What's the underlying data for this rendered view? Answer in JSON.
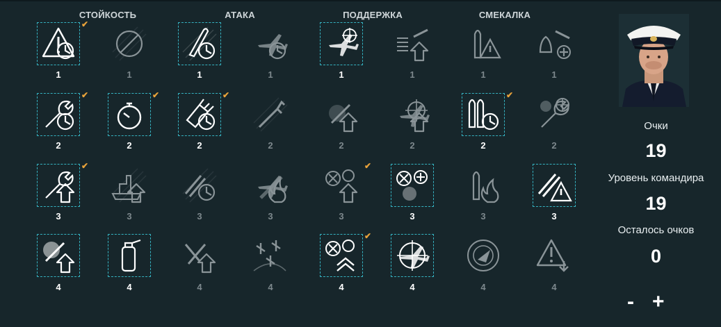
{
  "categories": [
    "СТОЙКОСТЬ",
    "АТАКА",
    "ПОДДЕРЖКА",
    "СМЕКАЛКА"
  ],
  "skills": [
    [
      {
        "icon": "warning-timer-icon",
        "level": "1",
        "selected": true,
        "checked": true
      },
      {
        "icon": "no-aa-icon",
        "level": "1",
        "selected": false,
        "checked": false
      },
      {
        "icon": "torpedo-timer-icon",
        "level": "1",
        "selected": true,
        "checked": false
      },
      {
        "icon": "plane-timer-icon",
        "level": "1",
        "selected": false,
        "checked": false
      },
      {
        "icon": "plane-target-icon",
        "level": "1",
        "selected": true,
        "checked": false
      },
      {
        "icon": "plane-upgrade-icon",
        "level": "1",
        "selected": false,
        "checked": false
      },
      {
        "icon": "torpedo-warning-icon",
        "level": "1",
        "selected": false,
        "checked": false
      },
      {
        "icon": "bomb-plane-heal-icon",
        "level": "1",
        "selected": false,
        "checked": false
      }
    ],
    [
      {
        "icon": "wrench-timer-icon",
        "level": "2",
        "selected": true,
        "checked": true
      },
      {
        "icon": "stopwatch-icon",
        "level": "2",
        "selected": true,
        "checked": true
      },
      {
        "icon": "gun-timer-icon",
        "level": "2",
        "selected": true,
        "checked": true
      },
      {
        "icon": "shell-upgrade-icon",
        "level": "2",
        "selected": false,
        "checked": false
      },
      {
        "icon": "explosion-upgrade-icon",
        "level": "2",
        "selected": false,
        "checked": false
      },
      {
        "icon": "plane-crosshair-upgrade-icon",
        "level": "2",
        "selected": false,
        "checked": false
      },
      {
        "icon": "torpedo-pair-timer-icon",
        "level": "2",
        "selected": true,
        "checked": true
      },
      {
        "icon": "fire-wrench-wheel-icon",
        "level": "2",
        "selected": false,
        "checked": false
      }
    ],
    [
      {
        "icon": "wrench-upgrade-icon",
        "level": "3",
        "selected": true,
        "checked": true
      },
      {
        "icon": "ship-upgrade-icon",
        "level": "3",
        "selected": false,
        "checked": false
      },
      {
        "icon": "shells-timer-icon",
        "level": "3",
        "selected": false,
        "checked": false
      },
      {
        "icon": "plane-fire-icon",
        "level": "3",
        "selected": false,
        "checked": false
      },
      {
        "icon": "aa-upgrade-icon",
        "level": "3",
        "selected": false,
        "checked": true
      },
      {
        "icon": "plane-heal-shield-icon",
        "level": "3",
        "selected": true,
        "checked": false
      },
      {
        "icon": "torpedo-fire-icon",
        "level": "3",
        "selected": false,
        "checked": false
      },
      {
        "icon": "shells-warning-icon",
        "level": "3",
        "selected": true,
        "checked": false
      }
    ],
    [
      {
        "icon": "flame-shield-upgrade-icon",
        "level": "4",
        "selected": true,
        "checked": false
      },
      {
        "icon": "extinguisher-icon",
        "level": "4",
        "selected": true,
        "checked": false
      },
      {
        "icon": "guns-upgrade-icon",
        "level": "4",
        "selected": false,
        "checked": false
      },
      {
        "icon": "squadron-icon",
        "level": "4",
        "selected": false,
        "checked": false
      },
      {
        "icon": "aa-double-upgrade-icon",
        "level": "4",
        "selected": true,
        "checked": true
      },
      {
        "icon": "plane-crosshair-icon",
        "level": "4",
        "selected": true,
        "checked": false
      },
      {
        "icon": "radar-icon",
        "level": "4",
        "selected": false,
        "checked": false
      },
      {
        "icon": "warning-down-icon",
        "level": "4",
        "selected": false,
        "checked": false
      }
    ]
  ],
  "panel": {
    "points_label": "Очки",
    "points_value": "19",
    "commander_level_label": "Уровень командира",
    "commander_level_value": "19",
    "remaining_label": "Осталось очков",
    "remaining_value": "0",
    "minus_label": "-",
    "plus_label": "+"
  },
  "colors": {
    "selected_border": "#35b3c2",
    "checkmark": "#e8a23a",
    "icon_active": "#ffffff",
    "icon_inactive": "#8a9498"
  }
}
